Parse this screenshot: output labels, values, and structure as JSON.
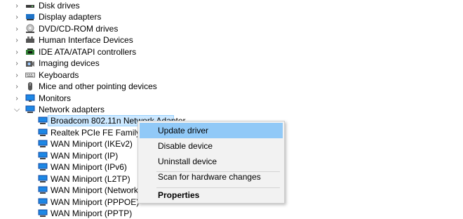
{
  "tree": {
    "categories": [
      {
        "label": "Disk drives",
        "icon": "disk-drive-icon"
      },
      {
        "label": "Display adapters",
        "icon": "display-adapter-icon"
      },
      {
        "label": "DVD/CD-ROM drives",
        "icon": "dvd-drive-icon"
      },
      {
        "label": "Human Interface Devices",
        "icon": "hid-icon"
      },
      {
        "label": "IDE ATA/ATAPI controllers",
        "icon": "ide-controller-icon"
      },
      {
        "label": "Imaging devices",
        "icon": "camera-icon"
      },
      {
        "label": "Keyboards",
        "icon": "keyboard-icon"
      },
      {
        "label": "Mice and other pointing devices",
        "icon": "mouse-icon"
      },
      {
        "label": "Monitors",
        "icon": "monitor-icon"
      },
      {
        "label": "Network adapters",
        "icon": "network-adapter-icon"
      }
    ],
    "network_children": [
      "Broadcom 802.11n Network Adapter",
      "Realtek PCIe FE Family Co",
      "WAN Miniport (IKEv2)",
      "WAN Miniport (IP)",
      "WAN Miniport (IPv6)",
      "WAN Miniport (L2TP)",
      "WAN Miniport (Network",
      "WAN Miniport (PPPOE)",
      "WAN Miniport (PPTP)"
    ]
  },
  "context_menu": {
    "update_driver": "Update driver",
    "disable_device": "Disable device",
    "uninstall_device": "Uninstall device",
    "scan_hardware": "Scan for hardware changes",
    "properties": "Properties"
  }
}
